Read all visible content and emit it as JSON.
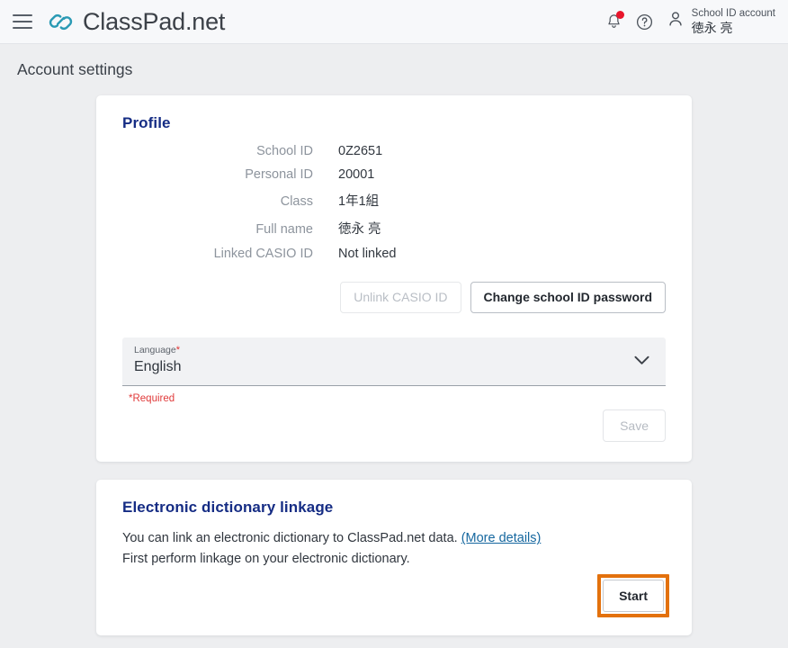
{
  "header": {
    "menu_icon": "hamburger-menu-icon",
    "logo_icon": "chain-link-logo-icon",
    "brand": "ClassPad.net",
    "notifications_icon": "bell-icon",
    "has_notification_dot": true,
    "help_icon": "question-mark-circle-icon",
    "avatar_icon": "person-icon",
    "account_label": "School ID account",
    "account_name": "徳永 亮"
  },
  "page": {
    "title": "Account settings"
  },
  "profile_card": {
    "title": "Profile",
    "rows": [
      {
        "label": "School ID",
        "value": "0Z2651"
      },
      {
        "label": "Personal ID",
        "value": "20001"
      },
      {
        "label": "Class",
        "value": "1年1組"
      },
      {
        "label": "Full name",
        "value": "徳永 亮"
      },
      {
        "label": "Linked CASIO ID",
        "value": "Not linked"
      }
    ],
    "unlink_button": "Unlink CASIO ID",
    "unlink_disabled": true,
    "change_password_button": "Change school ID password",
    "language_field": {
      "label": "Language",
      "required_marker": "*",
      "value": "English",
      "chevron_icon": "chevron-down-icon"
    },
    "required_note": "*Required",
    "save_button": "Save",
    "save_disabled": true
  },
  "dictionary_card": {
    "title": "Electronic dictionary linkage",
    "line1_text": "You can link an electronic dictionary to ClassPad.net data. ",
    "line1_link": "(More details)",
    "line2_text": "First perform linkage on your electronic dictionary.",
    "start_button": "Start",
    "highlight_color": "#e3710d"
  },
  "colors": {
    "page_background": "#edeef0",
    "topbar_background": "#f7f8fa",
    "card_background": "#ffffff",
    "heading_blue": "#152c84",
    "logo_teal": "#2a9ab4",
    "link_blue": "#15679f",
    "required_red": "#e03a3a",
    "notification_red": "#e8152b",
    "highlight_orange": "#e3710d"
  }
}
